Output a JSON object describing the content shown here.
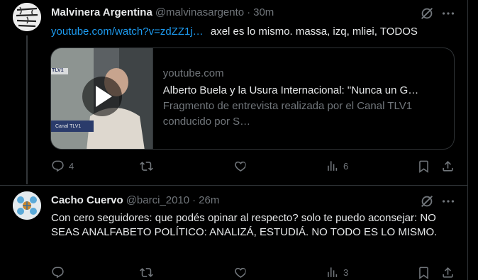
{
  "tweets": [
    {
      "avatar_icon": "logo-malvinas-icon",
      "avatar_text": "LAS MALVINAS SON ARGENTINAS",
      "name": "Malvinera Argentina",
      "handle": "@malvinasargento",
      "time": "30m",
      "link": "youtube.com/watch?v=zdZZ1j…",
      "text": "axel es lo mismo. massa, izq, mliei, TODOS",
      "card": {
        "domain": "youtube.com",
        "title": "Alberto Buela y la Usura Internacional: \"Nunca un G…",
        "description": "Fragmento de entrevista realizada por el Canal TLV1 conducido por S…",
        "media_label": "Canal TLV1",
        "media_corner": "TLV1"
      },
      "replies": "4",
      "reposts": "",
      "likes": "",
      "views": "6"
    },
    {
      "avatar_icon": "logo-cacho-icon",
      "name": "Cacho Cuervo",
      "handle": "@barci_2010",
      "time": "26m",
      "text": "Con cero seguidores: que podés opinar al respecto? solo te puedo aconsejar: NO SEAS ANALFABETO POLÍTICO: ANALIZÁ, ESTUDIÁ. NO TODO ES LO MISMO.",
      "replies": "",
      "reposts": "",
      "likes": "",
      "views": "3"
    }
  ],
  "colors": {
    "background": "#000000",
    "text": "#e7e9ea",
    "muted": "#71767b",
    "link": "#1d9bf0",
    "border": "#2f3336"
  }
}
